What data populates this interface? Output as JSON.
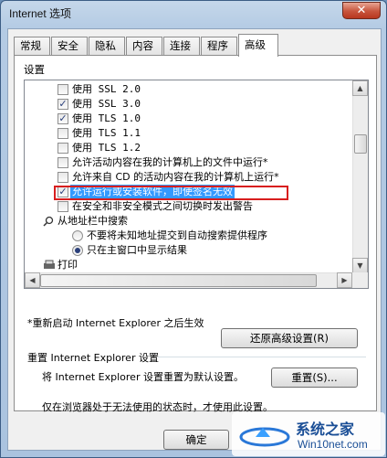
{
  "window": {
    "title": "Internet 选项",
    "close_glyph": "✕"
  },
  "tabs": [
    {
      "label": "常规"
    },
    {
      "label": "安全"
    },
    {
      "label": "隐私"
    },
    {
      "label": "内容"
    },
    {
      "label": "连接"
    },
    {
      "label": "程序"
    },
    {
      "label": "高级",
      "active": true
    }
  ],
  "settings": {
    "group_label": "设置",
    "items": [
      {
        "label": "使用 SSL 2.0",
        "checked": false
      },
      {
        "label": "使用 SSL 3.0",
        "checked": true
      },
      {
        "label": "使用 TLS 1.0",
        "checked": true
      },
      {
        "label": "使用 TLS 1.1",
        "checked": false
      },
      {
        "label": "使用 TLS 1.2",
        "checked": false
      },
      {
        "label": "允许活动内容在我的计算机上的文件中运行*",
        "checked": false
      },
      {
        "label": "允许来自 CD 的活动内容在我的计算机上运行*",
        "checked": false
      },
      {
        "label": "允许运行或安装软件，即使签名无效",
        "checked": true,
        "selected": true
      },
      {
        "label": "在安全和非安全模式之间切换时发出警告",
        "checked": false
      }
    ],
    "category": {
      "label": "从地址栏中搜索",
      "icon": "search-icon"
    },
    "radios": [
      {
        "label": "不要将未知地址提交到自动搜索提供程序",
        "checked": false
      },
      {
        "label": "只在主窗口中显示结果",
        "checked": true
      }
    ],
    "next_category": {
      "label": "打印",
      "icon": "printer-icon"
    }
  },
  "restart_note": "*重新启动 Internet Explorer 之后生效",
  "restore_button": "还原高级设置(R)",
  "reset": {
    "title": "重置 Internet Explorer 设置",
    "description": "将 Internet Explorer 设置重置为默认设置。",
    "button": "重置(S)..."
  },
  "bottom_note": "仅在浏览器处于无法使用的状态时，才使用此设置。",
  "footer": {
    "ok_button": "确定"
  },
  "watermark": {
    "title": "系统之家",
    "url": "Win10net.com"
  }
}
